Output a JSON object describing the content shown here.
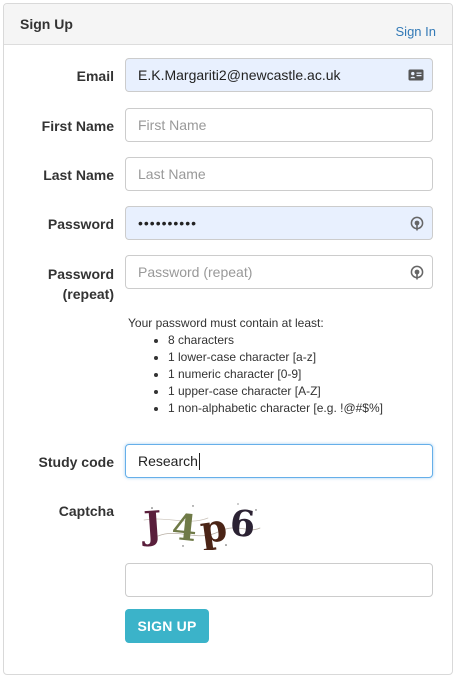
{
  "header": {
    "title": "Sign Up",
    "signin_link": "Sign In"
  },
  "form": {
    "email": {
      "label": "Email",
      "value": "E.K.Margariti2@newcastle.ac.uk",
      "icon": "contact-card-icon"
    },
    "first_name": {
      "label": "First Name",
      "placeholder": "First Name"
    },
    "last_name": {
      "label": "Last Name",
      "placeholder": "Last Name"
    },
    "password": {
      "label": "Password",
      "value": "••••••••••",
      "icon": "password-manager-icon"
    },
    "password_repeat": {
      "label_line1": "Password",
      "label_line2": "(repeat)",
      "placeholder": "Password (repeat)",
      "icon": "password-manager-icon"
    },
    "rules": {
      "intro": "Your password must contain at least:",
      "items": [
        "8 characters",
        "1 lower-case character [a-z]",
        "1 numeric character [0-9]",
        "1 upper-case character [A-Z]",
        "1 non-alphabetic character [e.g. !@#$%]"
      ]
    },
    "study_code": {
      "label": "Study code",
      "value": "Research"
    },
    "captcha": {
      "label": "Captcha",
      "text": "J4p6",
      "value": ""
    },
    "submit_label": "SIGN UP"
  },
  "colors": {
    "accent": "#3bb3c9",
    "link": "#337ab7",
    "autofill": "#e8f0fe",
    "focus": "#66afe9"
  }
}
